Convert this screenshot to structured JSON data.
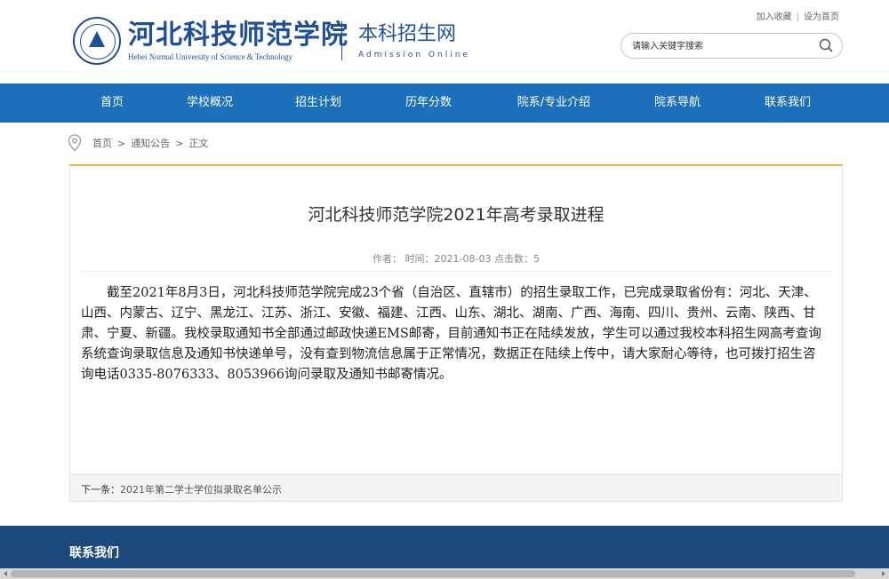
{
  "header": {
    "school_name_cn": "河北科技师范学院",
    "school_name_en": "Hebei Normal University of Science & Technology",
    "site_name_cn": "本科招生网",
    "site_name_en": "Admission Online",
    "top_links": [
      "加入收藏",
      "设为首页"
    ],
    "search_placeholder": "请输入关键字搜索"
  },
  "nav": {
    "items": [
      "首页",
      "学校概况",
      "招生计划",
      "历年分数",
      "院系/专业介绍",
      "院系导航",
      "联系我们"
    ]
  },
  "breadcrumb": {
    "items": [
      "首页",
      "通知公告",
      "正文"
    ]
  },
  "article": {
    "title": "河北科技师范学院2021年高考录取进程",
    "meta": "作者： 时间：2021-08-03 点击数：5",
    "body": "截至2021年8月3日，河北科技师范学院完成23个省（自治区、直辖市）的招生录取工作，已完成录取省份有：河北、天津、山西、内蒙古、辽宁、黑龙江、江苏、浙江、安徽、福建、江西、山东、湖北、湖南、广西、海南、四川、贵州、云南、陕西、甘肃、宁夏、新疆。我校录取通知书全部通过邮政快递EMS邮寄，目前通知书正在陆续发放，学生可以通过我校本科招生网高考查询系统查询录取信息及通知书快递单号，没有查到物流信息属于正常情况，数据正在陆续上传中，请大家耐心等待，也可拨打招生咨询电话0335-8076333、8053966询问录取及通知书邮寄情况。",
    "next_label": "下一条：",
    "next_link": "2021年第二学士学位拟录取名单公示"
  },
  "footer": {
    "title": "联系我们"
  },
  "colors": {
    "nav_bg": "#1b6fbb",
    "brand_blue": "#1f4f9a",
    "accent_gold": "#f0b13c",
    "footer_bg": "#1c4a7d"
  },
  "icons": [
    "school-emblem-icon",
    "search-icon",
    "location-pin-icon"
  ]
}
